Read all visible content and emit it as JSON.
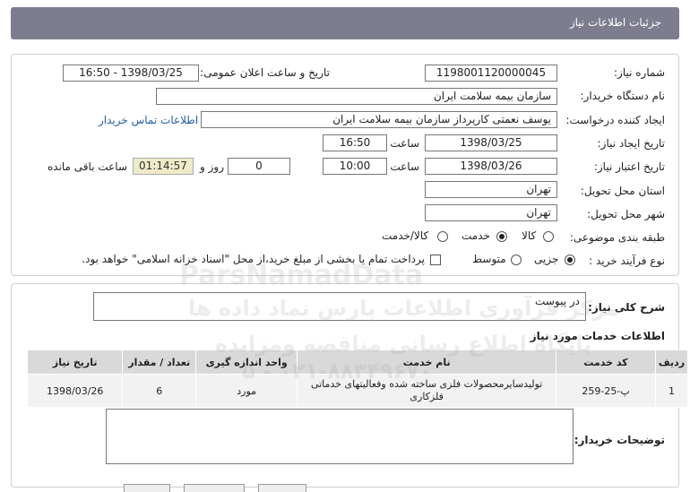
{
  "header": {
    "title": "جزئیات اطلاعات نیاز"
  },
  "info": {
    "need_number_label": "شماره نیاز:",
    "need_number": "1198001120000045",
    "announce_label": "تاریخ و ساعت اعلان عمومی:",
    "announce_value": "1398/03/25 - 16:50",
    "buyer_org_label": "نام دستگاه خریدار:",
    "buyer_org": "سازمان بیمه سلامت ایران",
    "creator_label": "ایجاد کننده درخواست:",
    "creator": "یوسف نعمتی کارپرداز سازمان بیمه سلامت ایران",
    "contact_link": "اطلاعات تماس خریدار",
    "create_date_label": "تاریخ ایجاد نیاز:",
    "create_date": "1398/03/25",
    "time_label": "ساعت",
    "create_time": "16:50",
    "valid_date_label": "تاریخ اعتبار نیاز:",
    "valid_date": "1398/03/26",
    "valid_time": "10:00",
    "day_label": "روز و",
    "days": "0",
    "remaining_time": "01:14:57",
    "remaining_label": "ساعت باقی مانده",
    "province_label": "استان محل تحویل:",
    "province": "تهران",
    "city_label": "شهر محل تحویل:",
    "city": "تهران",
    "category_label": "طبقه بندی موضوعی:",
    "category_options": [
      "کالا",
      "خدمت",
      "کالا/خدمت"
    ],
    "category_selected": "خدمت",
    "process_label": "نوع فرآیند خرید :",
    "process_options": [
      "جزیی",
      "متوسط"
    ],
    "process_selected": "جزیی",
    "payment_note": "پرداخت تمام یا بخشی از مبلغ خرید،از محل \"اسناد خزانه اسلامی\" خواهد بود."
  },
  "summary": {
    "label": "شرح کلی نیاز:",
    "value": "در پیوست"
  },
  "services": {
    "title": "اطلاعات خدمات مورد نیاز",
    "headers": [
      "ردیف",
      "کد خدمت",
      "نام خدمت",
      "واحد اندازه گیری",
      "تعداد / مقدار",
      "تاریخ نیاز"
    ],
    "rows": [
      [
        "1",
        "پ-25-259",
        "تولیدسایرمحصولات فلزی ساخته شده وفعالیتهای خدماتی فلزکاری",
        "مورد",
        "6",
        "1398/03/26"
      ]
    ]
  },
  "buyer_notes": {
    "label": "توضیحات خریدار:"
  },
  "watermark": {
    "line1": "ParsNamadData",
    "line2": "مرکز فرآوری اطلاعات پارس نماد داده ها",
    "line3": "پایگاه اطلاع رسانی مناقصه ومزایده",
    "line4": "۰۲۱-۸۸۳۴۹۶۷۰ - ۵"
  }
}
